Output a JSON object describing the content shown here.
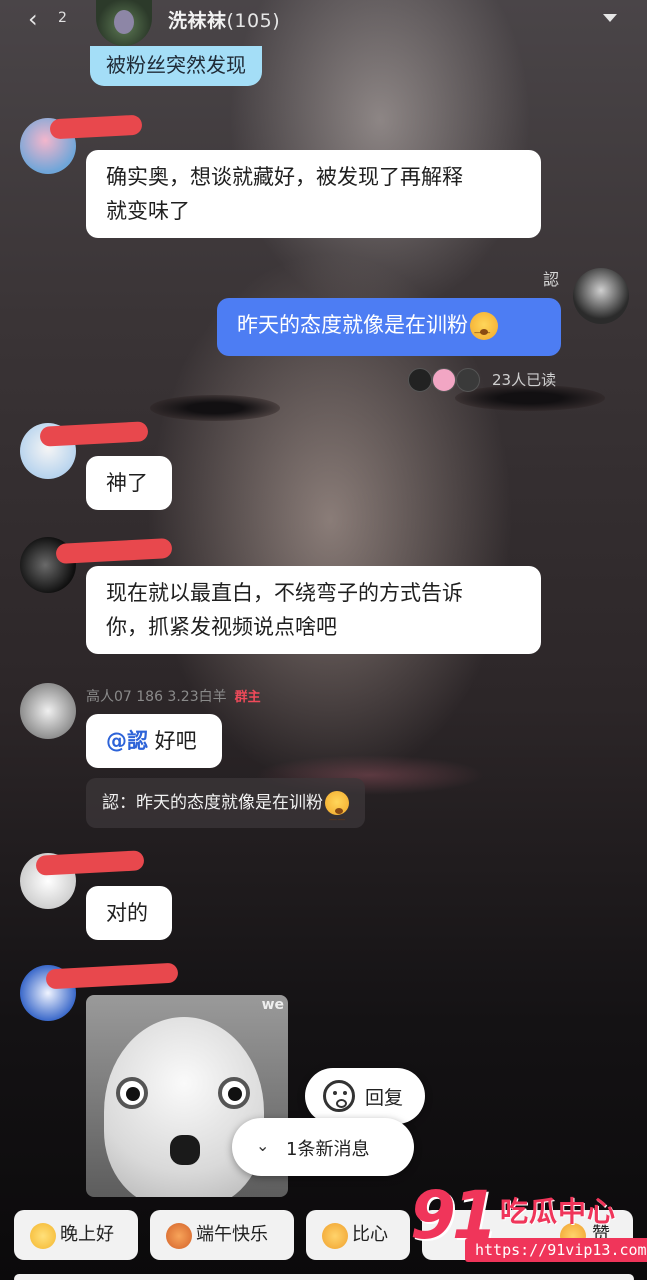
{
  "header": {
    "back_count": "2",
    "group_name": "洗袜袜",
    "member_count": "(105)"
  },
  "messages": [
    {
      "id": "m0",
      "type": "text",
      "text": "被粉丝突然发现"
    },
    {
      "id": "m1",
      "type": "text",
      "text": "确实奥，想谈就藏好，被发现了再解释就变味了",
      "line1": "确实奥，想谈就藏好，被发现了再解释",
      "line2": "就变味了"
    },
    {
      "id": "m2",
      "type": "text",
      "sender": "認",
      "text": "昨天的态度就像是在训粉",
      "mine": true,
      "read_status": "23人已读"
    },
    {
      "id": "m3",
      "type": "text",
      "text": "神了"
    },
    {
      "id": "m4",
      "type": "text",
      "line1": "现在就以最直白，不绕弯子的方式告诉",
      "line2": "你，抓紧发视频说点啥吧"
    },
    {
      "id": "m5",
      "type": "text",
      "sender": "高人07  186  3.23白羊",
      "badge": "群主",
      "mention": "@認",
      "text": " 好吧",
      "quote": "認：昨天的态度就像是在训粉"
    },
    {
      "id": "m6",
      "type": "text",
      "text": "对的"
    },
    {
      "id": "m7",
      "type": "sticker",
      "mark": "we"
    }
  ],
  "actions": {
    "reply": "回复",
    "new_messages": "1条新消息"
  },
  "quick_replies": [
    "晚上好",
    "端午快乐",
    "比心",
    "赞"
  ],
  "watermark": {
    "brand_number": "91",
    "brand_text": "吃瓜中心",
    "url": "https://91vip13.com"
  },
  "colors": {
    "my_bubble": "#4d7df3",
    "other_bubble": "#ffffff",
    "owner_badge": "#ef4a5a",
    "watermark": "#f0355a"
  }
}
